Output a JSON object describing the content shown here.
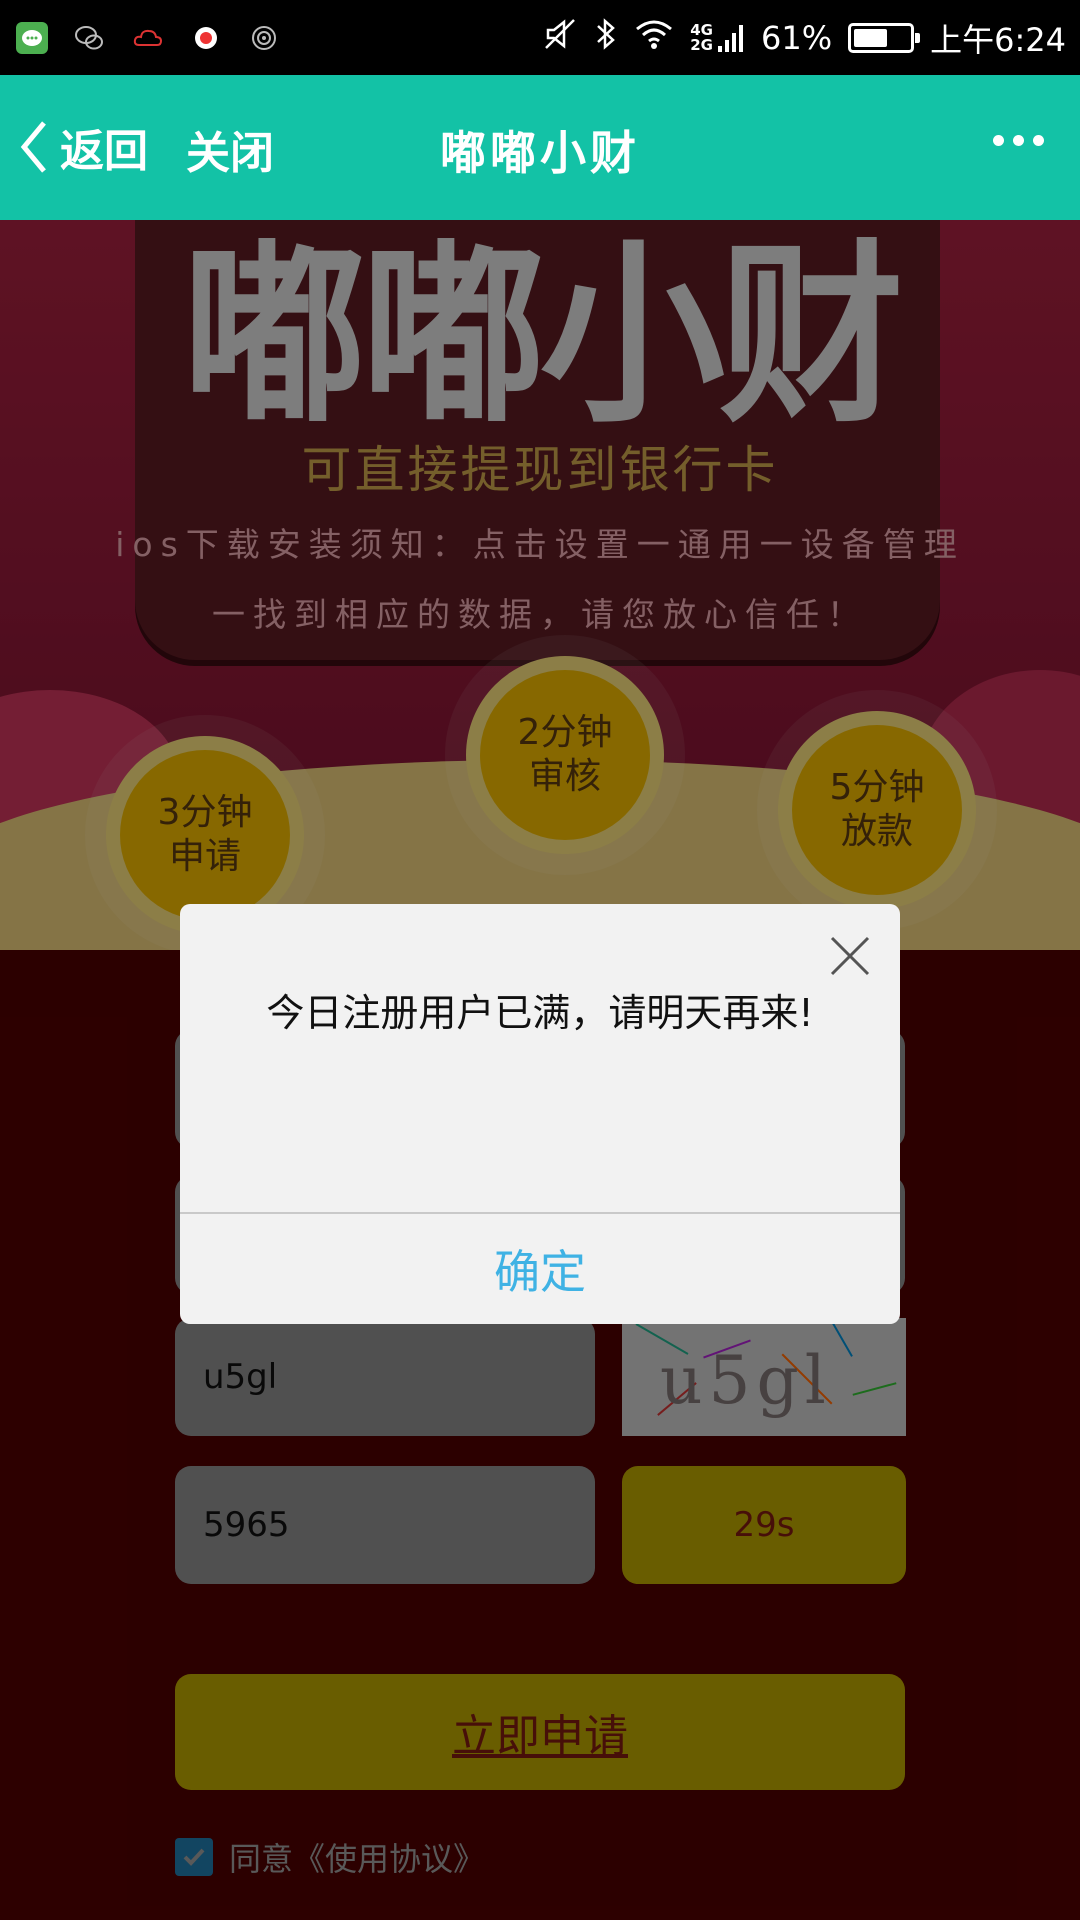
{
  "status_bar": {
    "battery_percent": "61%",
    "battery_level": 0.61,
    "time": "上午6:24",
    "network": "4G\n2G",
    "left_icons": [
      "message-app-icon",
      "wechat-icon",
      "cloud-icon",
      "record-icon",
      "sync-icon"
    ],
    "right_icons": [
      "mute-icon",
      "bluetooth-icon",
      "wifi-icon",
      "signal-icon",
      "battery-icon"
    ]
  },
  "title_bar": {
    "back_label": "返回",
    "close_label": "关闭",
    "title": "嘟嘟小财",
    "more_icon": "more-dots-icon"
  },
  "banner": {
    "logo_text": "嘟嘟小财",
    "subtitle": "可直接提现到银行卡",
    "tip_line1": "ios下载安装须知：点击设置一通用一设备管理",
    "tip_line2": "一找到相应的数据，请您放心信任！",
    "steps": [
      {
        "line1": "3分钟",
        "line2": "申请"
      },
      {
        "line1": "2分钟",
        "line2": "审核"
      },
      {
        "line1": "5分钟",
        "line2": "放款"
      }
    ]
  },
  "form": {
    "captcha_input_value": "u5gl",
    "captcha_image_text": "u5gl",
    "sms_code_value": "5965",
    "countdown_label": "29s",
    "apply_button_label": "立即申请",
    "agree_label": "同意《使用协议》",
    "agree_checked": true
  },
  "modal": {
    "message": "今日注册用户已满，请明天再来!",
    "confirm_label": "确定"
  },
  "colors": {
    "title_bar_bg": "#13c2a6",
    "banner_bg": "#a3203e",
    "page_bg": "#4d0000",
    "button_yellow": "#b6a000",
    "confirm_text": "#3fb2e4"
  }
}
